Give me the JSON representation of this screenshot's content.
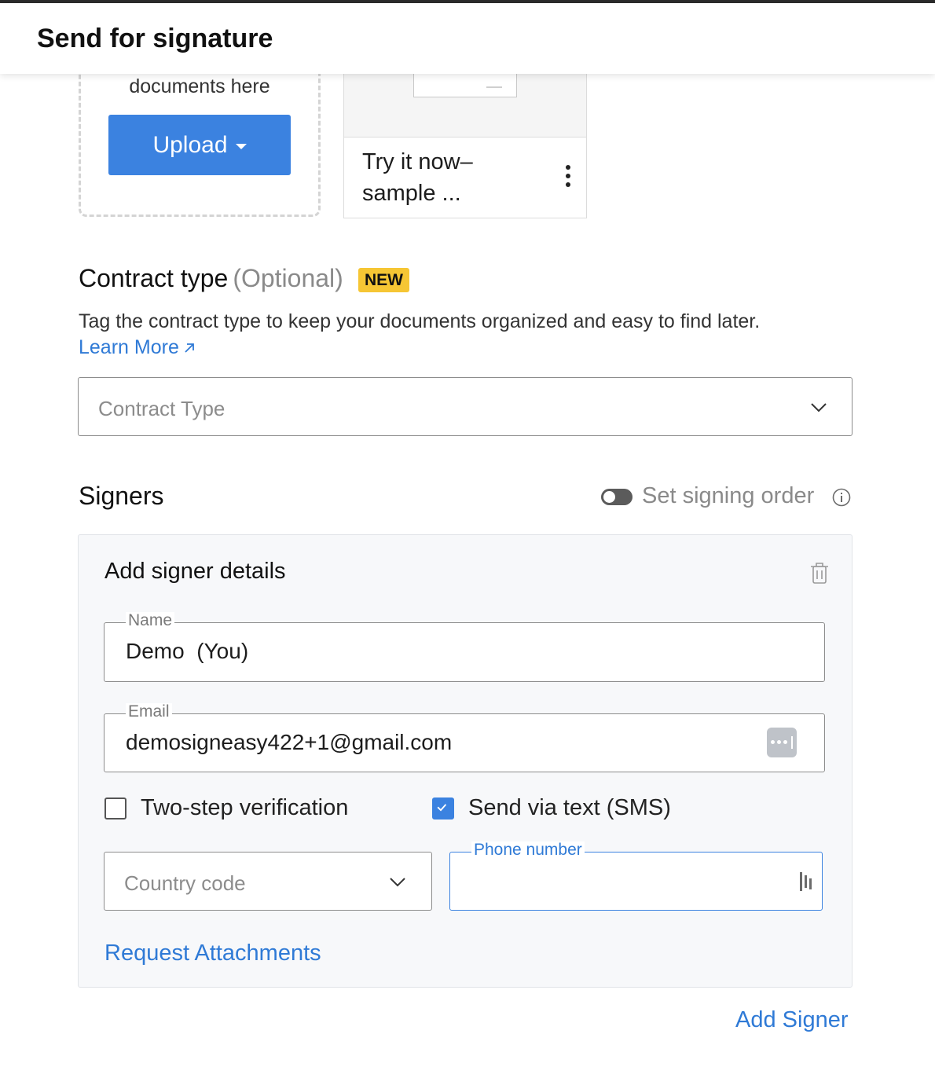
{
  "header": {
    "title": "Send for signature"
  },
  "upload": {
    "drop_text": "documents here",
    "button_label": "Upload"
  },
  "sample": {
    "name": "Try it now–sample ..."
  },
  "contract_type": {
    "title": "Contract type",
    "optional": "(Optional)",
    "badge": "NEW",
    "description": "Tag the contract type to keep your documents organized and easy to find later.",
    "learn_more": "Learn More",
    "select_placeholder": "Contract Type"
  },
  "signers": {
    "title": "Signers",
    "signing_order_label": "Set signing order",
    "signing_order_enabled": false,
    "panel": {
      "title": "Add signer details",
      "name_label": "Name",
      "name_value": "Demo  (You)",
      "email_label": "Email",
      "email_value": "demosigneasy422+1@gmail.com",
      "two_step_label": "Two-step verification",
      "two_step_checked": false,
      "sms_label": "Send via text (SMS)",
      "sms_checked": true,
      "country_placeholder": "Country code",
      "phone_label": "Phone number",
      "phone_value": "",
      "request_attachments": "Request Attachments"
    },
    "add_signer": "Add Signer"
  },
  "colors": {
    "accent": "#3b82e0",
    "link": "#2f7ad6",
    "badge": "#f6c634"
  },
  "icons": [
    "caret-down-icon",
    "kebab-icon",
    "external-link-icon",
    "chevron-down-icon",
    "toggle-icon",
    "info-icon",
    "trash-icon",
    "password-manager-icon",
    "check-icon",
    "phone-autofill-icon"
  ]
}
